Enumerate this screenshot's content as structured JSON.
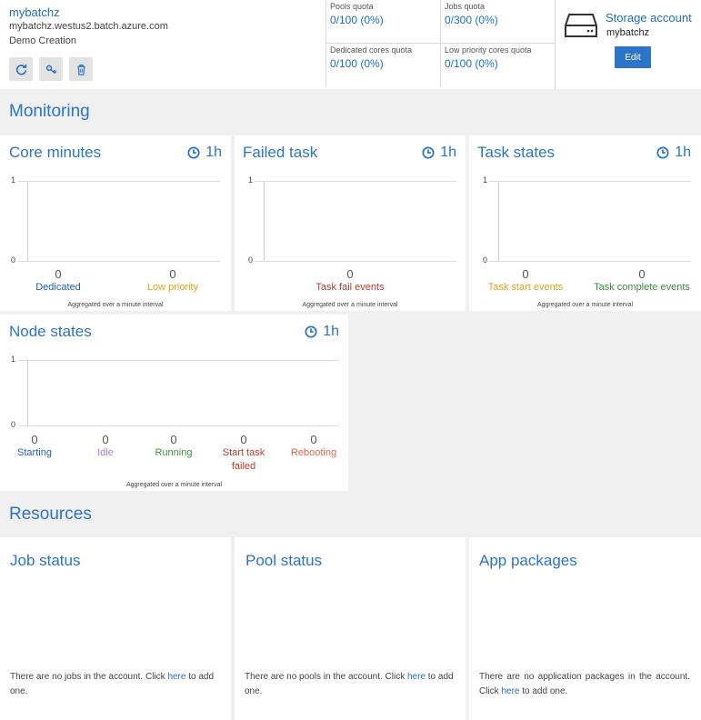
{
  "account": {
    "name": "mybatchz",
    "url": "mybatchz.westus2.batch.azure.com",
    "description": "Demo Creation",
    "actions": [
      {
        "name": "refresh-icon"
      },
      {
        "name": "key-icon"
      },
      {
        "name": "delete-icon"
      }
    ]
  },
  "quotas": {
    "pools": {
      "label": "Pools quota",
      "value": "0/100 (0%)"
    },
    "jobs": {
      "label": "Jobs quota",
      "value": "0/300 (0%)"
    },
    "dedicated_cores": {
      "label": "Dedicated cores quota",
      "value": "0/100 (0%)"
    },
    "low_priority_cores": {
      "label": "Low priority cores quota",
      "value": "0/100 (0%)"
    }
  },
  "storage": {
    "title": "Storage account",
    "name": "mybatchz",
    "edit_label": "Edit"
  },
  "monitoring": {
    "title": "Monitoring",
    "range": "1h",
    "axis_top": "1",
    "axis_bottom": "0",
    "aggregate_note": "Aggregated over a minute interval",
    "core_minutes": {
      "title": "Core minutes",
      "metrics": [
        {
          "value": "0",
          "label": "Dedicated",
          "color": "#1f5fbf"
        },
        {
          "value": "0",
          "label": "Low priority",
          "color": "#e6a117"
        }
      ]
    },
    "failed_task": {
      "title": "Failed task",
      "metrics": [
        {
          "value": "0",
          "label": "Task fail events",
          "color": "#c0392b"
        }
      ]
    },
    "task_states": {
      "title": "Task states",
      "metrics": [
        {
          "value": "0",
          "label": "Task start events",
          "color": "#e6a117"
        },
        {
          "value": "0",
          "label": "Task complete events",
          "color": "#3a8f3a"
        }
      ]
    },
    "node_states": {
      "title": "Node states",
      "metrics": [
        {
          "value": "0",
          "label": "Starting",
          "color": "#1f5fbf"
        },
        {
          "value": "0",
          "label": "Idle",
          "color": "#b07bd6"
        },
        {
          "value": "0",
          "label": "Running",
          "color": "#3a8f3a"
        },
        {
          "value": "0",
          "label": "Start task failed",
          "color": "#c0392b"
        },
        {
          "value": "0",
          "label": "Rebooting",
          "color": "#e8604c"
        }
      ]
    }
  },
  "resources": {
    "title": "Resources",
    "job_status": {
      "title": "Job status",
      "text_before": "There are no jobs in the account. Click ",
      "link": "here",
      "text_after": " to add one."
    },
    "pool_status": {
      "title": "Pool status",
      "text_before": "There are no pools in the account. Click ",
      "link": "here",
      "text_after": " to add one."
    },
    "app_packages": {
      "title": "App packages",
      "text_before": "There are no application packages in the account. Click ",
      "link": "here",
      "text_after": " to add one."
    }
  }
}
